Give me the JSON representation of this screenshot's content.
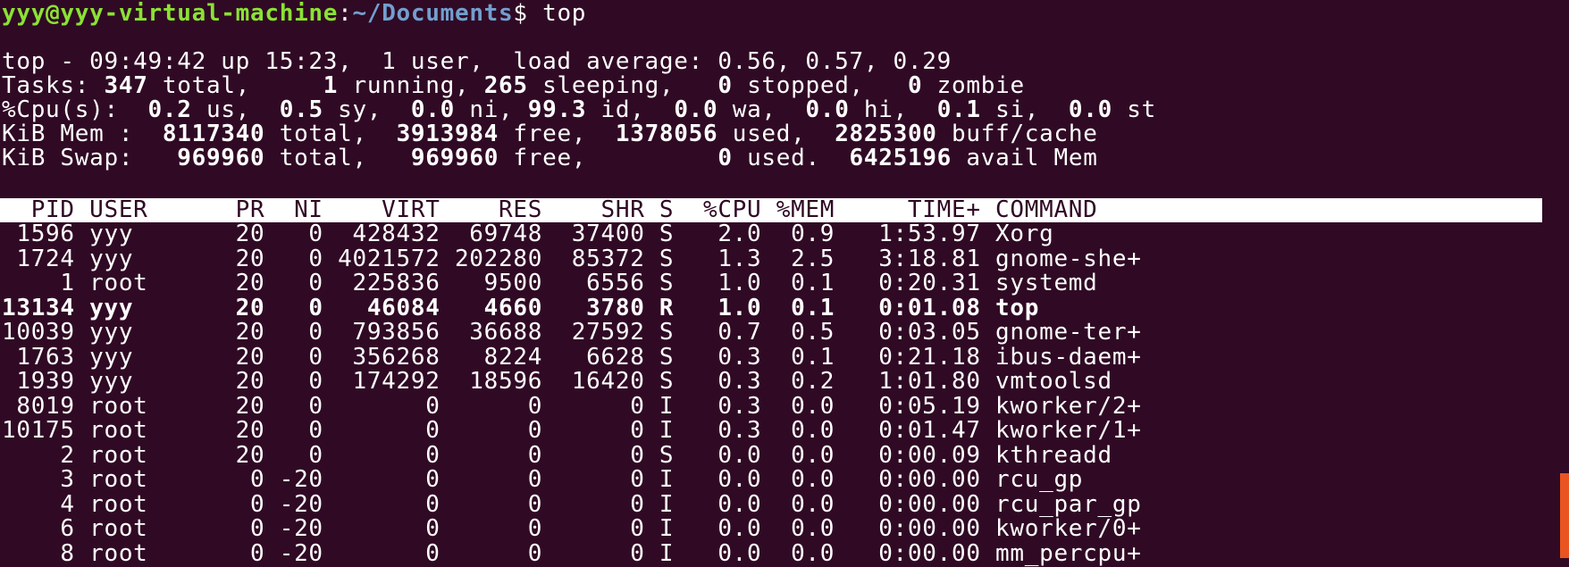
{
  "prompt": {
    "user_host": "yyy@yyy-virtual-machine",
    "sep": ":",
    "path": "~/Documents",
    "symbol": "$",
    "command": " top"
  },
  "summary": {
    "uptime": "top - 09:49:42 up 15:23,  1 user,  load average: 0.56, 0.57, 0.29",
    "tasks": {
      "label": "Tasks: ",
      "total": "347",
      "total_l": " total,   ",
      "running": "  1",
      "running_l": " running, ",
      "sleeping": "265",
      "sleeping_l": " sleeping,   ",
      "stopped": "0",
      "stopped_l": " stopped,   ",
      "zombie": "0",
      "zombie_l": " zombie"
    },
    "cpu": {
      "label": "%Cpu(s):  ",
      "us": "0.2",
      "us_l": " us,  ",
      "sy": "0.5",
      "sy_l": " sy,  ",
      "ni": "0.0",
      "ni_l": " ni, ",
      "id": "99.3",
      "id_l": " id,  ",
      "wa": "0.0",
      "wa_l": " wa,  ",
      "hi": "0.0",
      "hi_l": " hi,  ",
      "si": "0.1",
      "si_l": " si,  ",
      "st": "0.0",
      "st_l": " st"
    },
    "mem": {
      "label": "KiB Mem :  ",
      "total": "8117340",
      "total_l": " total,  ",
      "free": "3913984",
      "free_l": " free,  ",
      "used": "1378056",
      "used_l": " used,  ",
      "buff": "2825300",
      "buff_l": " buff/cache"
    },
    "swap": {
      "label": "KiB Swap:   ",
      "total": "969960",
      "total_l": " total,   ",
      "free": "969960",
      "free_l": " free,         ",
      "used": "0",
      "used_l": " used.  ",
      "avail": "6425196",
      "avail_l": " avail Mem"
    }
  },
  "table": {
    "header": "  PID USER      PR  NI    VIRT    RES    SHR S  %CPU %MEM     TIME+ COMMAND",
    "rows": [
      {
        "line": " 1596 yyy       20   0  428432  69748  37400 S   2.0  0.9   1:53.97 Xorg",
        "bold": false
      },
      {
        "line": " 1724 yyy       20   0 4021572 202280  85372 S   1.3  2.5   3:18.81 gnome-she+",
        "bold": false
      },
      {
        "line": "    1 root      20   0  225836   9500   6556 S   1.0  0.1   0:20.31 systemd",
        "bold": false
      },
      {
        "line": "13134 yyy       20   0   46084   4660   3780 R   1.0  0.1   0:01.08 top",
        "bold": true
      },
      {
        "line": "10039 yyy       20   0  793856  36688  27592 S   0.7  0.5   0:03.05 gnome-ter+",
        "bold": false
      },
      {
        "line": " 1763 yyy       20   0  356268   8224   6628 S   0.3  0.1   0:21.18 ibus-daem+",
        "bold": false
      },
      {
        "line": " 1939 yyy       20   0  174292  18596  16420 S   0.3  0.2   1:01.80 vmtoolsd",
        "bold": false
      },
      {
        "line": " 8019 root      20   0       0      0      0 I   0.3  0.0   0:05.19 kworker/2+",
        "bold": false
      },
      {
        "line": "10175 root      20   0       0      0      0 I   0.3  0.0   0:01.47 kworker/1+",
        "bold": false
      },
      {
        "line": "    2 root      20   0       0      0      0 S   0.0  0.0   0:00.09 kthreadd",
        "bold": false
      },
      {
        "line": "    3 root       0 -20       0      0      0 I   0.0  0.0   0:00.00 rcu_gp",
        "bold": false
      },
      {
        "line": "    4 root       0 -20       0      0      0 I   0.0  0.0   0:00.00 rcu_par_gp",
        "bold": false
      },
      {
        "line": "    6 root       0 -20       0      0      0 I   0.0  0.0   0:00.00 kworker/0+",
        "bold": false
      },
      {
        "line": "    8 root       0 -20       0      0      0 I   0.0  0.0   0:00.00 mm_percpu+",
        "bold": false
      }
    ]
  },
  "colors": {
    "background": "#300a24",
    "prompt_user": "#8ae234",
    "prompt_path": "#729fcf",
    "scrollbar": "#e95420"
  }
}
